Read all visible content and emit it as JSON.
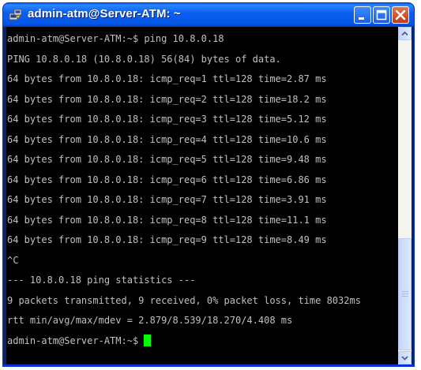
{
  "window": {
    "title": "admin-atm@Server-ATM: ~",
    "icon": "putty-terminal-icon",
    "controls": [
      "minimize-icon",
      "maximize-icon",
      "close-icon"
    ]
  },
  "terminal": {
    "lines": [
      "admin-atm@Server-ATM:~$ ping 10.8.0.18",
      "PING 10.8.0.18 (10.8.0.18) 56(84) bytes of data.",
      "64 bytes from 10.8.0.18: icmp_req=1 ttl=128 time=2.87 ms",
      "64 bytes from 10.8.0.18: icmp_req=2 ttl=128 time=18.2 ms",
      "64 bytes from 10.8.0.18: icmp_req=3 ttl=128 time=5.12 ms",
      "64 bytes from 10.8.0.18: icmp_req=4 ttl=128 time=10.6 ms",
      "64 bytes from 10.8.0.18: icmp_req=5 ttl=128 time=9.48 ms",
      "64 bytes from 10.8.0.18: icmp_req=6 ttl=128 time=6.86 ms",
      "64 bytes from 10.8.0.18: icmp_req=7 ttl=128 time=3.91 ms",
      "64 bytes from 10.8.0.18: icmp_req=8 ttl=128 time=11.1 ms",
      "64 bytes from 10.8.0.18: icmp_req=9 ttl=128 time=8.49 ms",
      "^C",
      "--- 10.8.0.18 ping statistics ---",
      "9 packets transmitted, 9 received, 0% packet loss, time 8032ms",
      "rtt min/avg/max/mdev = 2.879/8.539/18.270/4.408 ms"
    ],
    "prompt": "admin-atm@Server-ATM:~$ ",
    "colors": {
      "background": "#000000",
      "text": "#c0c0c0",
      "cursor": "#00ff00"
    }
  },
  "scrollbar": {
    "up_icon": "scroll-up-arrow-icon",
    "down_icon": "scroll-down-arrow-icon"
  }
}
